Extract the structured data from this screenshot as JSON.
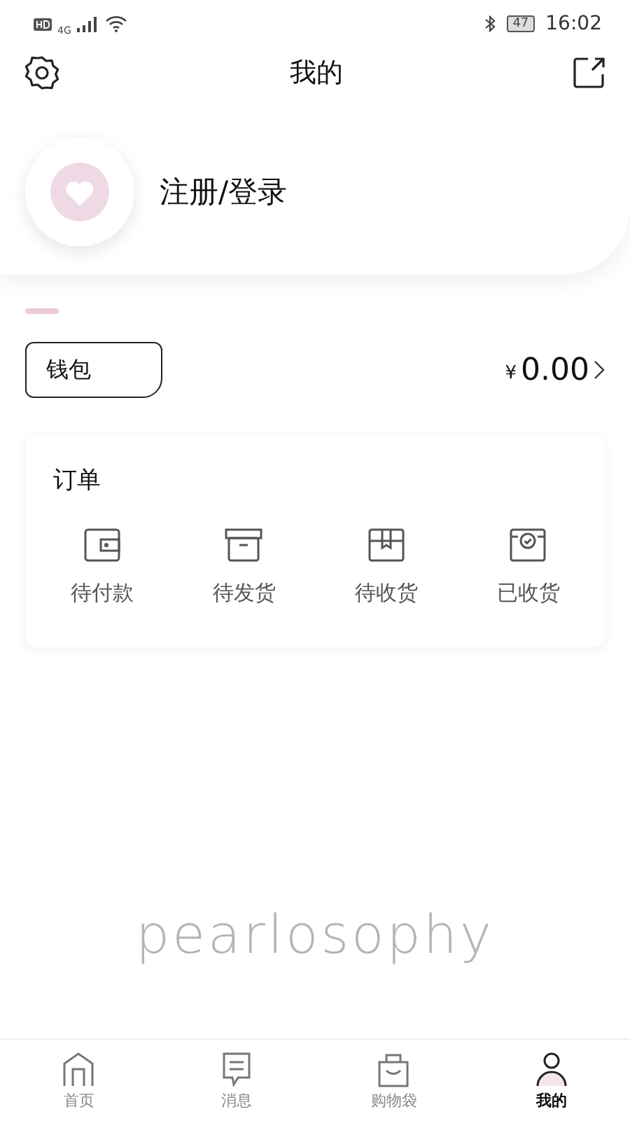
{
  "status_bar": {
    "network": "4G",
    "battery": "47",
    "time": "16:02"
  },
  "header": {
    "title": "我的"
  },
  "profile": {
    "login_label": "注册/登录"
  },
  "wallet": {
    "label": "钱包",
    "currency": "¥",
    "amount": "0.00"
  },
  "orders": {
    "title": "订单",
    "items": [
      {
        "kind": "wallet",
        "label": "待付款"
      },
      {
        "kind": "box",
        "label": "待发货"
      },
      {
        "kind": "package",
        "label": "待收货"
      },
      {
        "kind": "received",
        "label": "已收货"
      }
    ]
  },
  "brand": "pearlosophy",
  "tab_bar": [
    {
      "kind": "home",
      "label": "首页",
      "selected": false
    },
    {
      "kind": "message",
      "label": "消息",
      "selected": false
    },
    {
      "kind": "bag",
      "label": "购物袋",
      "selected": false
    },
    {
      "kind": "me",
      "label": "我的",
      "selected": true
    }
  ]
}
